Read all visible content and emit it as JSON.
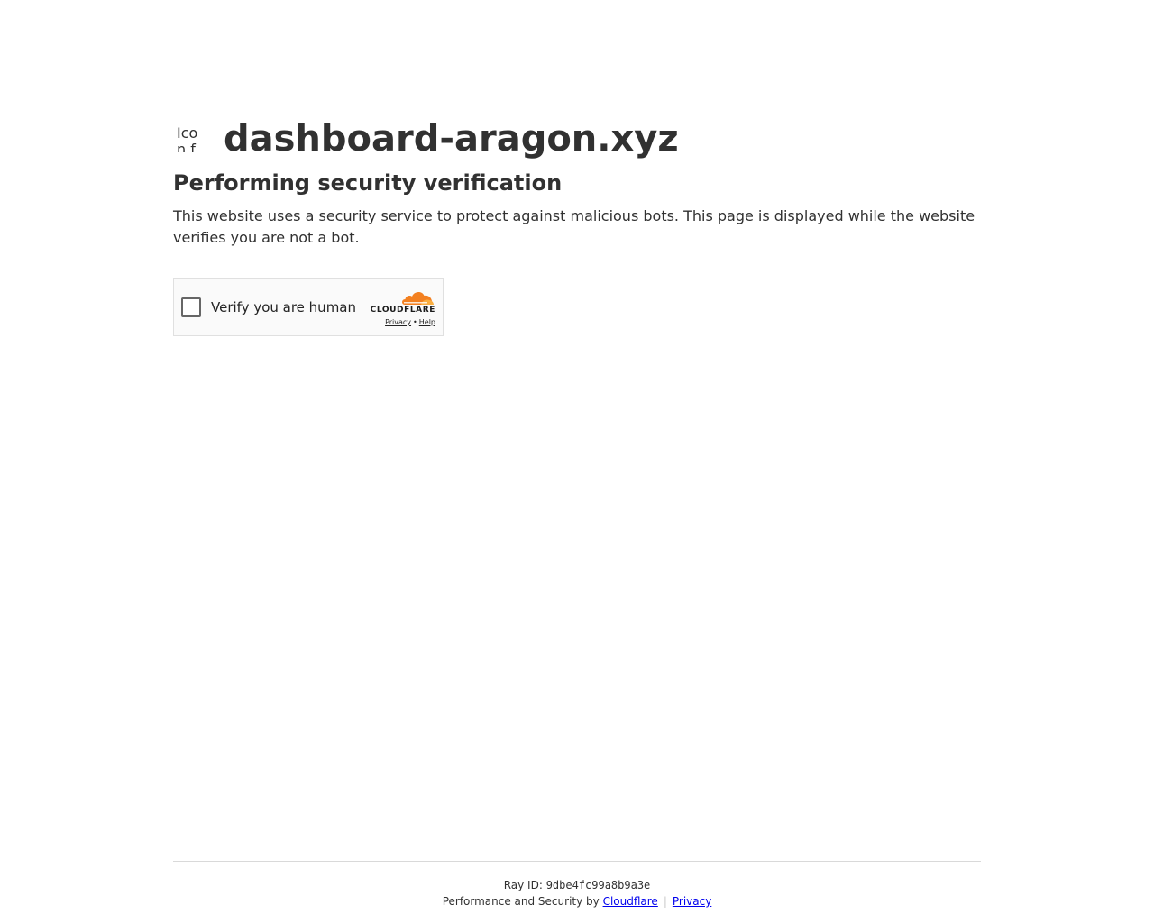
{
  "site": {
    "icon_alt": "Icon for dashboard-aragon.xyz",
    "name": "dashboard-aragon.xyz"
  },
  "main": {
    "heading": "Performing security verification",
    "description": "This website uses a security service to protect against malicious bots. This page is displayed while the website verifies you are not a bot."
  },
  "widget": {
    "checkbox_label": "Verify you are human",
    "brand_word": "CLOUDFLARE",
    "privacy_link": "Privacy",
    "separator": "•",
    "help_link": "Help"
  },
  "footer": {
    "ray_label": "Ray ID: ",
    "ray_id": "9dbe4fc99a8b9a3e",
    "perf_prefix": "Performance and Security by ",
    "cloudflare_link": "Cloudflare",
    "separator": "|",
    "privacy_link": "Privacy"
  },
  "colors": {
    "text": "#313131",
    "link": "#0000ee",
    "cloud_orange": "#f38020",
    "cloud_light": "#faae40"
  }
}
